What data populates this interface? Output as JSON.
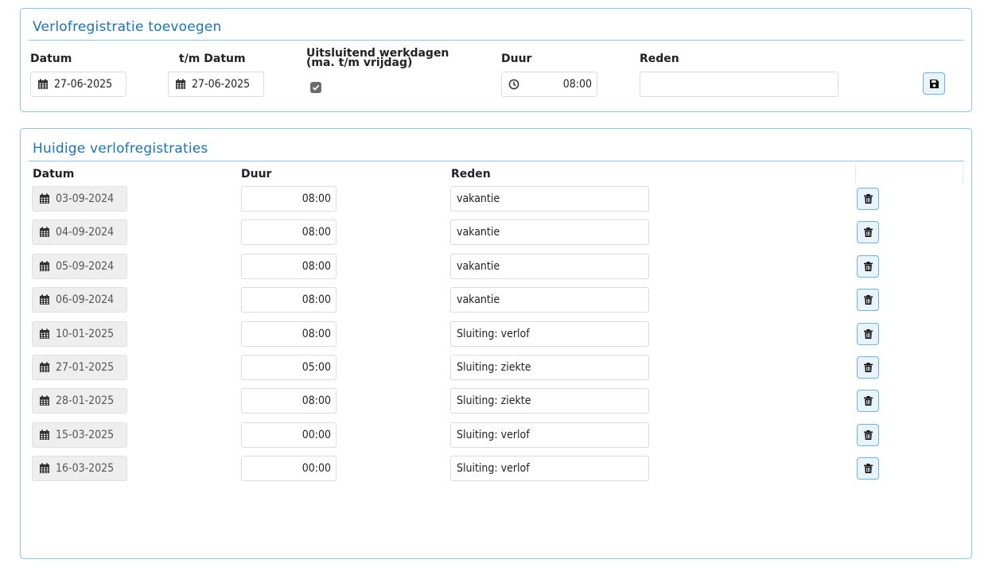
{
  "add_panel": {
    "title": "Verlofregistratie toevoegen",
    "labels": {
      "datum": "Datum",
      "tm_datum": "t/m Datum",
      "werkdagen_line1": "Uitsluitend werkdagen",
      "werkdagen_line2": "(ma. t/m vrijdag)",
      "duur": "Duur",
      "reden": "Reden"
    },
    "datum_value": "27-06-2025",
    "tm_datum_value": "27-06-2025",
    "werkdagen_checked": true,
    "duur_value": "08:00",
    "reden_value": ""
  },
  "list_panel": {
    "title": "Huidige verlofregistraties",
    "headers": {
      "datum": "Datum",
      "duur": "Duur",
      "reden": "Reden"
    },
    "rows": [
      {
        "datum": "03-09-2024",
        "duur": "08:00",
        "reden": "vakantie"
      },
      {
        "datum": "04-09-2024",
        "duur": "08:00",
        "reden": "vakantie"
      },
      {
        "datum": "05-09-2024",
        "duur": "08:00",
        "reden": "vakantie"
      },
      {
        "datum": "06-09-2024",
        "duur": "08:00",
        "reden": "vakantie"
      },
      {
        "datum": "10-01-2025",
        "duur": "08:00",
        "reden": "Sluiting: verlof"
      },
      {
        "datum": "27-01-2025",
        "duur": "05:00",
        "reden": "Sluiting: ziekte"
      },
      {
        "datum": "28-01-2025",
        "duur": "08:00",
        "reden": "Sluiting: ziekte"
      },
      {
        "datum": "15-03-2025",
        "duur": "00:00",
        "reden": "Sluiting: verlof"
      },
      {
        "datum": "16-03-2025",
        "duur": "00:00",
        "reden": "Sluiting: verlof"
      }
    ]
  },
  "icons": {
    "date": "calendar-icon",
    "time": "clock-icon",
    "save": "save-icon",
    "delete": "trash-icon",
    "check": "check-icon"
  },
  "colors": {
    "panel_border": "#8cc4e6",
    "title": "#1a73b8",
    "button_bg": "#e8f3fc",
    "button_border": "#6fb1e0"
  }
}
